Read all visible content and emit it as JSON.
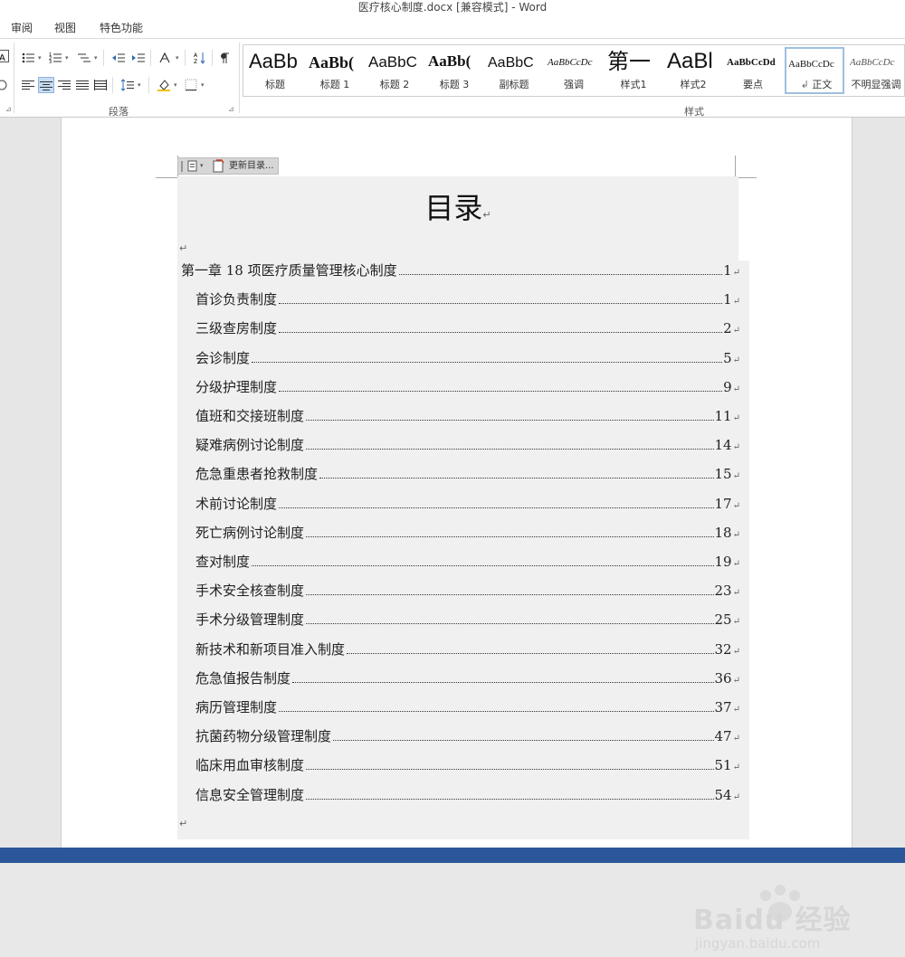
{
  "window": {
    "title": "医疗核心制度.docx [兼容模式] - Word"
  },
  "tabs": [
    {
      "label": "审阅"
    },
    {
      "label": "视图"
    },
    {
      "label": "特色功能"
    }
  ],
  "ribbon": {
    "paragraph_group_label": "段落",
    "styles_group_label": "样式",
    "styles": [
      {
        "sample": "AaBb",
        "name": "标题"
      },
      {
        "sample": "AaBb(",
        "name": "标题 1"
      },
      {
        "sample": "AaBbC",
        "name": "标题 2"
      },
      {
        "sample": "AaBb(",
        "name": "标题 3"
      },
      {
        "sample": "AaBbC",
        "name": "副标题"
      },
      {
        "sample": "AaBbCcDc",
        "name": "强调"
      },
      {
        "sample": "第一",
        "name": "样式1"
      },
      {
        "sample": "AaBl",
        "name": "样式2"
      },
      {
        "sample": "AaBbCcDd",
        "name": "要点"
      },
      {
        "sample": "AaBbCcDc",
        "name": "正文",
        "mark": "↲"
      },
      {
        "sample": "AaBbCcDc",
        "name": "不明显强调"
      }
    ]
  },
  "document": {
    "toc_update_label": "更新目录...",
    "toc_title": "目录",
    "pilcrow": "↵",
    "toc_entries": [
      {
        "title": "第一章    18 项医疗质量管理核心制度",
        "page": "1",
        "level": 1
      },
      {
        "title": "首诊负责制度",
        "page": "1",
        "level": 2
      },
      {
        "title": "三级查房制度",
        "page": "2",
        "level": 2
      },
      {
        "title": "会诊制度",
        "page": "5",
        "level": 2
      },
      {
        "title": "分级护理制度",
        "page": "9",
        "level": 2
      },
      {
        "title": "值班和交接班制度",
        "page": "11",
        "level": 2
      },
      {
        "title": "疑难病例讨论制度",
        "page": "14",
        "level": 2
      },
      {
        "title": "危急重患者抢救制度",
        "page": "15",
        "level": 2
      },
      {
        "title": "术前讨论制度",
        "page": "17",
        "level": 2
      },
      {
        "title": "死亡病例讨论制度",
        "page": "18",
        "level": 2
      },
      {
        "title": "查对制度",
        "page": "19",
        "level": 2
      },
      {
        "title": "手术安全核查制度",
        "page": "23",
        "level": 2
      },
      {
        "title": "手术分级管理制度",
        "page": "25",
        "level": 2
      },
      {
        "title": "新技术和新项目准入制度",
        "page": "32",
        "level": 2
      },
      {
        "title": "危急值报告制度",
        "page": "36",
        "level": 2
      },
      {
        "title": "病历管理制度",
        "page": "37",
        "level": 2
      },
      {
        "title": "抗菌药物分级管理制度",
        "page": "47",
        "level": 2
      },
      {
        "title": "临床用血审核制度",
        "page": "51",
        "level": 2
      },
      {
        "title": "信息安全管理制度",
        "page": "54",
        "level": 2
      }
    ]
  },
  "watermark": {
    "text": "Baidu 经验",
    "url": "jingyan.baidu.com"
  },
  "colors": {
    "statusbar": "#2b579a",
    "accent": "#c6dcf2"
  }
}
